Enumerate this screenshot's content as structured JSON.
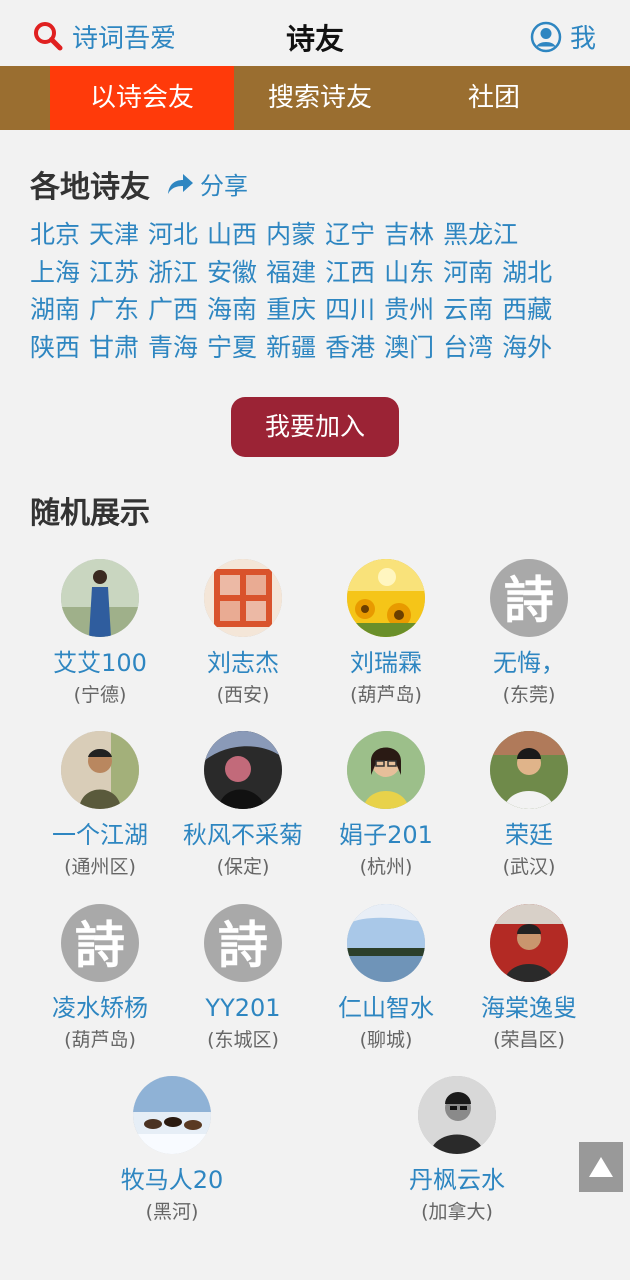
{
  "header": {
    "brand_label": "诗词吾爱",
    "page_title": "诗友",
    "user_label": "我"
  },
  "tabs": [
    "以诗会友",
    "搜索诗友",
    "社团"
  ],
  "regions_section": {
    "title": "各地诗友",
    "share_label": "分享",
    "rows": [
      [
        "北京",
        "天津",
        "河北",
        "山西",
        "内蒙",
        "辽宁",
        "吉林",
        "黑龙江"
      ],
      [
        "上海",
        "江苏",
        "浙江",
        "安徽",
        "福建",
        "江西",
        "山东",
        "河南",
        "湖北"
      ],
      [
        "湖南",
        "广东",
        "广西",
        "海南",
        "重庆",
        "四川",
        "贵州",
        "云南",
        "西藏"
      ],
      [
        "陕西",
        "甘肃",
        "青海",
        "宁夏",
        "新疆",
        "香港",
        "澳门",
        "台湾",
        "海外"
      ]
    ]
  },
  "join_button": "我要加入",
  "random_section": {
    "title": "随机展示",
    "members": [
      {
        "name": "艾艾100",
        "location": "(宁德)",
        "avatar": "photo-woman-blue-dress"
      },
      {
        "name": "刘志杰",
        "location": "(西安)",
        "avatar": "seal-stamp"
      },
      {
        "name": "刘瑞霖",
        "location": "(葫芦岛)",
        "avatar": "sunflowers"
      },
      {
        "name": "无悔，",
        "location": "(东莞)",
        "avatar": "shi-default"
      },
      {
        "name": "一个江湖",
        "location": "(通州区)",
        "avatar": "photo-man"
      },
      {
        "name": "秋风不采菊",
        "location": "(保定)",
        "avatar": "photo-dark-figure"
      },
      {
        "name": "娟子201",
        "location": "(杭州)",
        "avatar": "photo-woman-glasses"
      },
      {
        "name": "荣廷",
        "location": "(武汉)",
        "avatar": "photo-man-white-shirt"
      },
      {
        "name": "凌水矫杨",
        "location": "(葫芦岛)",
        "avatar": "shi-default"
      },
      {
        "name": "YY201",
        "location": "(东城区)",
        "avatar": "shi-default"
      },
      {
        "name": "仁山智水",
        "location": "(聊城)",
        "avatar": "landscape-lake"
      },
      {
        "name": "海棠逸叟",
        "location": "(荣昌区)",
        "avatar": "photo-man-red-bg"
      },
      {
        "name": "牧马人20",
        "location": "(黑河)",
        "avatar": "horses-snow"
      },
      {
        "name": "丹枫云水",
        "location": "(加拿大)",
        "avatar": "photo-man-bw"
      }
    ],
    "default_avatar_char": "詩"
  },
  "colors": {
    "link_blue": "#2e86c1",
    "tabbar_brown": "#9a6e30",
    "active_tab": "#ff3a0a",
    "join_button": "#9b2335",
    "search_icon": "#e02020"
  }
}
